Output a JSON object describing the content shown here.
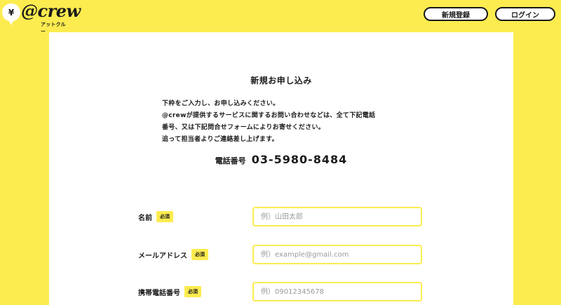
{
  "header": {
    "logo_text": "@crew",
    "logo_sub": "アットクルー",
    "logo_symbol": "¥",
    "register_label": "新規登録",
    "login_label": "ログイン"
  },
  "form": {
    "title": "新規お申し込み",
    "intro": [
      "下枠をご入力し、お申し込みください。",
      "@crewが提供するサービスに関するお問い合わせなどは、全て下記電話",
      "番号、又は下記問合せフォームによりお寄せください。",
      "追って担当者よりご連絡差し上げます。"
    ],
    "phone_label": "電話番号",
    "phone_number": "03-5980-8484",
    "fields": [
      {
        "label": "名前",
        "required": "必須",
        "placeholder": "例）山田太郎",
        "value": ""
      },
      {
        "label": "メールアドレス",
        "required": "必須",
        "placeholder": "例）example@gmail.com",
        "value": ""
      },
      {
        "label": "携帯電話番号",
        "required": "必須",
        "placeholder": "例）09012345678",
        "value": ""
      }
    ]
  },
  "colors": {
    "brand_yellow": "#fcec4f",
    "text": "#1a1a1a",
    "card": "#ffffff"
  },
  "icons": {
    "logo": "yen-speech-bubble-icon"
  }
}
